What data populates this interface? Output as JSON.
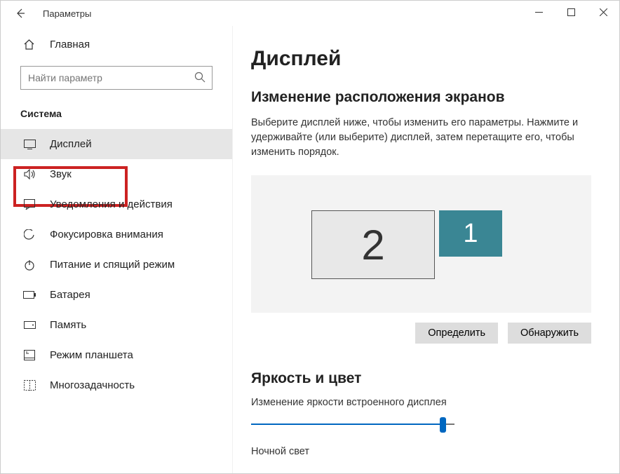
{
  "titlebar": {
    "title": "Параметры"
  },
  "sidebar": {
    "home": "Главная",
    "search_placeholder": "Найти параметр",
    "section": "Система",
    "items": [
      {
        "label": "Дисплей",
        "active": true
      },
      {
        "label": "Звук"
      },
      {
        "label": "Уведомления и действия"
      },
      {
        "label": "Фокусировка внимания"
      },
      {
        "label": "Питание и спящий режим"
      },
      {
        "label": "Батарея"
      },
      {
        "label": "Память"
      },
      {
        "label": "Режим планшета"
      },
      {
        "label": "Многозадачность"
      }
    ]
  },
  "main": {
    "title": "Дисплей",
    "arrange_heading": "Изменение расположения экранов",
    "arrange_desc": "Выберите дисплей ниже, чтобы изменить его параметры. Нажмите и удерживайте (или выберите) дисплей, затем перетащите его, чтобы изменить порядок.",
    "display1": "1",
    "display2": "2",
    "identify": "Определить",
    "detect": "Обнаружить",
    "brightness_heading": "Яркость и цвет",
    "brightness_label": "Изменение яркости встроенного дисплея",
    "night_light": "Ночной свет"
  }
}
